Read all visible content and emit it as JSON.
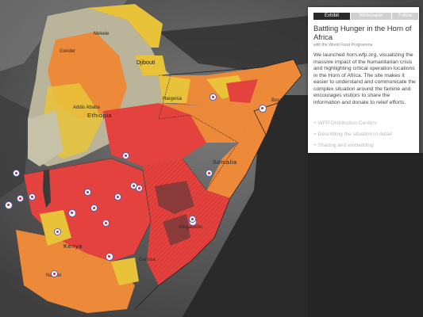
{
  "panel": {
    "tabs": [
      {
        "label": "Exhibit",
        "active": true
      },
      {
        "label": "Whitepaper",
        "active": false
      },
      {
        "label": "Follow",
        "active": false
      }
    ],
    "title": "Battling Hunger in the Horn of Africa",
    "subtitle": "with the World Food Programme",
    "body": "We launched horn.wfp.org, visualizing the massive impact of the humanitarian crisis and highlighting critical operation locations in the Horn of Africa. The site makes it easier to understand and communicate the complex situation around the famine and encourages visitors to share the information and donate to relief efforts.",
    "links": [
      "+ WFP Distribution Centers",
      "+ Describing the situation in detail",
      "+ Sharing and embedding"
    ]
  },
  "map": {
    "colors": {
      "background": "#5a5a5a",
      "stressed": "#e8c33a",
      "crisis": "#ed8a3a",
      "emergency": "#e4423e",
      "famine": "#7a3a3a",
      "marker_ring": "#5a5fb0",
      "marker_dot": "#d2232a"
    },
    "country_labels": [
      "Ethiopia",
      "Kenya",
      "Somalia"
    ],
    "city_labels": [
      "Djibouti",
      "Hargeisa",
      "Mogadishu",
      "Bosaso",
      "Mekele",
      "Gonder",
      "Addis Ababa",
      "Nairobi",
      "Garissa"
    ],
    "marker_count": 20
  }
}
